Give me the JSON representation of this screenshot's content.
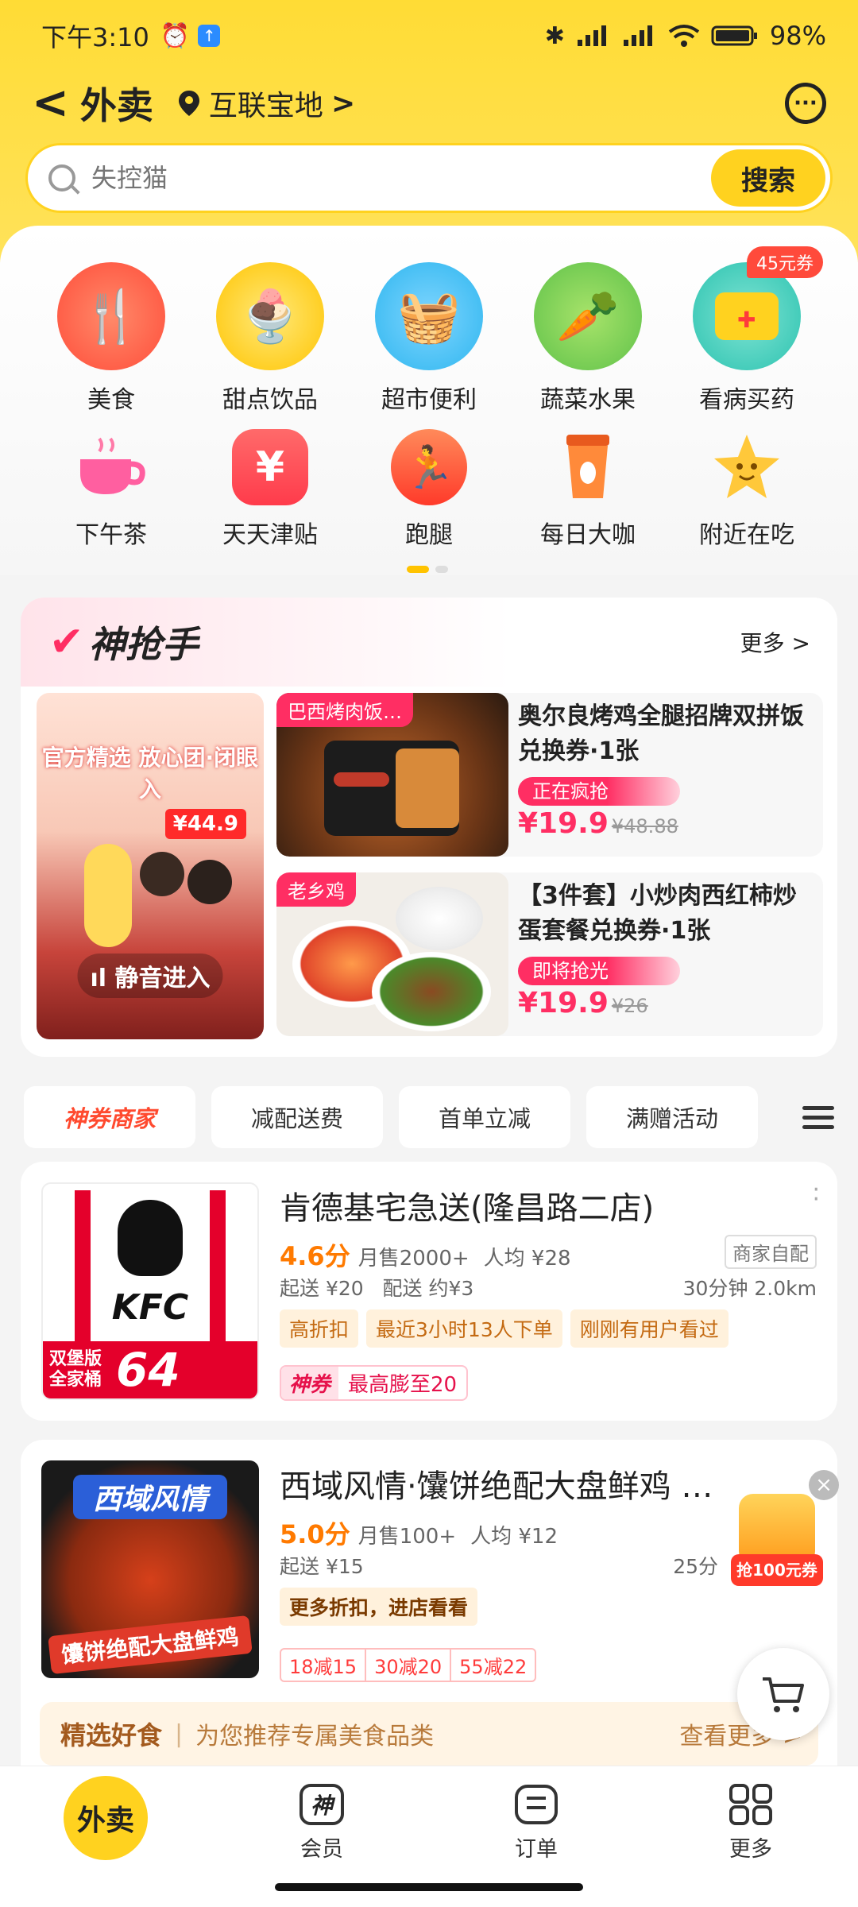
{
  "status": {
    "time": "下午3:10",
    "battery": "98%"
  },
  "header": {
    "back": "<",
    "title": "外卖",
    "location": "互联宝地",
    "location_chevron": ">"
  },
  "search": {
    "placeholder": "失控猫",
    "button": "搜索"
  },
  "categories": [
    {
      "label": "美食",
      "icon": "utensils-icon"
    },
    {
      "label": "甜点饮品",
      "icon": "dessert-icon"
    },
    {
      "label": "超市便利",
      "icon": "basket-icon"
    },
    {
      "label": "蔬菜水果",
      "icon": "vegetable-icon"
    },
    {
      "label": "看病买药",
      "icon": "medicine-kit-icon",
      "badge": "45元券"
    },
    {
      "label": "下午茶",
      "icon": "teacup-icon"
    },
    {
      "label": "天天津贴",
      "icon": "yuan-coupon-icon",
      "glyph": "¥"
    },
    {
      "label": "跑腿",
      "icon": "runner-icon"
    },
    {
      "label": "每日大咖",
      "icon": "coffee-cup-icon"
    },
    {
      "label": "附近在吃",
      "icon": "star-face-icon"
    }
  ],
  "flash": {
    "title": "神抢手",
    "more": "更多 >",
    "live": {
      "headline": "官方精选 放心团·闭眼入",
      "price": "¥44.9",
      "mute": "静音进入"
    },
    "deals": [
      {
        "tag": "巴西烤肉饭…",
        "name": "奥尔良烤鸡全腿招牌双拼饭兑换券·1张",
        "status": "正在疯抢",
        "price": "¥19.9",
        "old_price": "¥48.88"
      },
      {
        "tag": "老乡鸡",
        "name": "【3件套】小炒肉西红柿炒蛋套餐兑换券·1张",
        "status": "即将抢光",
        "price": "¥19.9",
        "old_price": "¥26"
      }
    ]
  },
  "filters": [
    "神券商家",
    "减配送费",
    "首单立减",
    "满赠活动"
  ],
  "stores": [
    {
      "name": "肯德基宅急送(隆昌路二店)",
      "rating": "4.6分",
      "monthly": "月售2000+",
      "avg": "人均 ¥28",
      "self_delivery": "商家自配",
      "min_order": "起送 ¥20",
      "delivery_fee": "配送 约¥3",
      "time_dist": "30分钟  2.0km",
      "tags": [
        "高折扣",
        "最近3小时13人下单",
        "刚刚有用户看过"
      ],
      "coupon_label": "神券",
      "coupon_text": "最高膨至20",
      "thumb_text": "KFC",
      "thumb_promo": "双堡版全家桶",
      "thumb_price": "64"
    },
    {
      "name": "西域风情·馕饼绝配大盘鲜鸡 …",
      "rating": "5.0分",
      "monthly": "月售100+",
      "avg": "人均 ¥12",
      "min_order": "起送 ¥15",
      "time_dist": "25分",
      "tag": "更多折扣，进店看看",
      "coupons": [
        "18减15",
        "30减20",
        "55减22"
      ],
      "thumb_title": "西域风情",
      "thumb_sub": "馕饼绝配大盘鲜鸡"
    }
  ],
  "selected": {
    "title": "精选好食",
    "desc": "为您推荐专属美食品类",
    "more": "查看更多 >"
  },
  "float_promo": "抢100元券",
  "nav": [
    {
      "label": "外卖"
    },
    {
      "label": "会员",
      "glyph": "神"
    },
    {
      "label": "订单"
    },
    {
      "label": "更多"
    }
  ]
}
